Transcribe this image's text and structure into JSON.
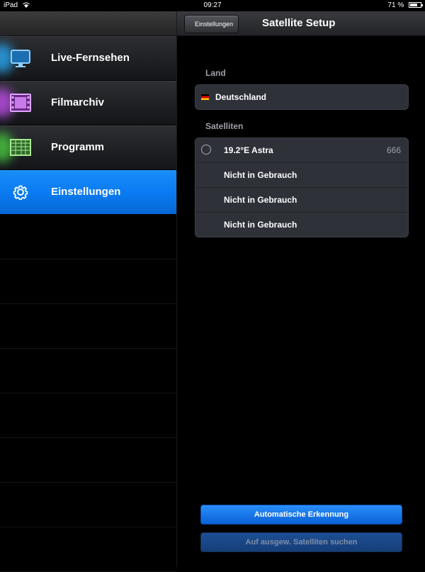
{
  "status_bar": {
    "device": "iPad",
    "time": "09:27",
    "battery": "71 %",
    "battery_level": 0.71
  },
  "sidebar": {
    "items": [
      {
        "label": "Live-Fernsehen",
        "icon": "tv-icon",
        "glow": "#2aa0e8"
      },
      {
        "label": "Filmarchiv",
        "icon": "film-icon",
        "glow": "#b84ce0"
      },
      {
        "label": "Programm",
        "icon": "program-grid-icon",
        "glow": "#46c040"
      },
      {
        "label": "Einstellungen",
        "icon": "gear-icon",
        "active": true
      }
    ]
  },
  "header": {
    "back_label": "Einstellungen",
    "title": "Satellite Setup"
  },
  "land": {
    "section_label": "Land",
    "country": "Deutschland",
    "flag_icon": "german-flag-icon"
  },
  "satellites": {
    "section_label": "Satelliten",
    "rows": [
      {
        "label": "19.2°E Astra",
        "value": "666"
      },
      {
        "label": "Nicht in Gebrauch"
      },
      {
        "label": "Nicht in Gebrauch"
      },
      {
        "label": "Nicht in Gebrauch"
      }
    ]
  },
  "buttons": {
    "auto_detect": "Automatische Erkennung",
    "search_selected": "Auf ausgew. Satelliten suchen"
  },
  "colors": {
    "accent": "#0a7bf2",
    "panel": "#2e3138"
  }
}
